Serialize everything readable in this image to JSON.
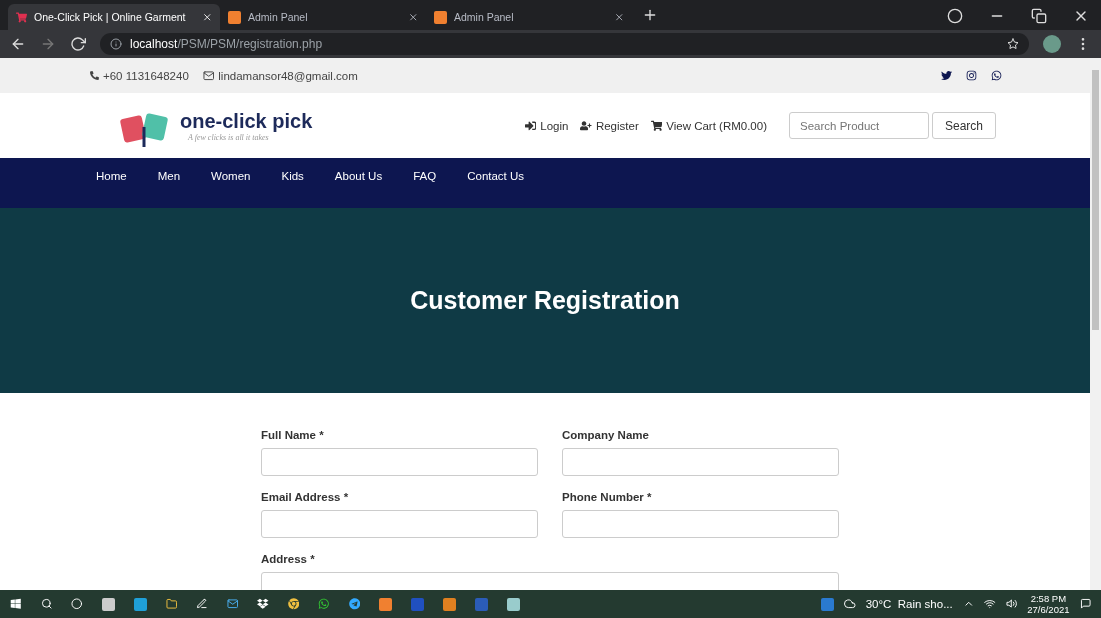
{
  "browser": {
    "tabs": [
      {
        "title": "One-Click Pick | Online Garment",
        "selected": true,
        "kind": "cart"
      },
      {
        "title": "Admin Panel",
        "selected": false,
        "kind": "xampp"
      },
      {
        "title": "Admin Panel",
        "selected": false,
        "kind": "xampp"
      }
    ],
    "address": {
      "host": "localhost",
      "path": "/PSM/PSM/registration.php"
    }
  },
  "top_bar": {
    "phone": "+60 1131648240",
    "email": "lindamansor48@gmail.com"
  },
  "logo": {
    "name": "one-click pick",
    "tagline": "A few clicks is all it takes"
  },
  "header_links": [
    {
      "label": "Login",
      "kind": "login"
    },
    {
      "label": "Register",
      "kind": "register"
    },
    {
      "label": "View Cart (RM0.00)",
      "kind": "cart"
    }
  ],
  "search": {
    "placeholder": "Search Product",
    "button": "Search"
  },
  "nav": [
    "Home",
    "Men",
    "Women",
    "Kids",
    "About Us",
    "FAQ",
    "Contact Us"
  ],
  "hero": {
    "title": "Customer Registration"
  },
  "form_rows": [
    [
      {
        "label": "Full Name *"
      },
      {
        "label": "Company Name"
      }
    ],
    [
      {
        "label": "Email Address *"
      },
      {
        "label": "Phone Number *"
      }
    ],
    [
      {
        "label": "Address *"
      }
    ]
  ],
  "taskbar": {
    "weather": "30°C  Rain sho...",
    "time": "2:58 PM",
    "date": "27/6/2021"
  }
}
